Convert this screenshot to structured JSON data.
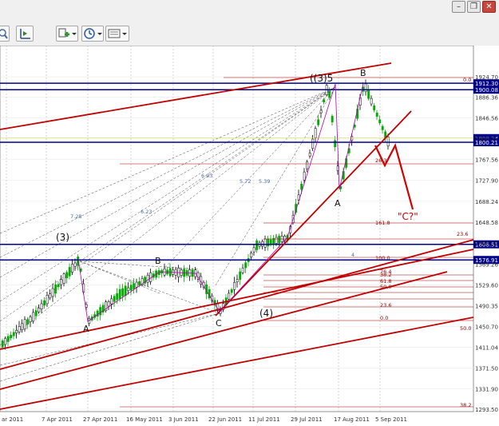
{
  "window": {
    "buttons": [
      {
        "name": "minimize",
        "glyph": "–"
      },
      {
        "name": "restore",
        "glyph": "❐"
      },
      {
        "name": "close",
        "glyph": "✕"
      }
    ]
  },
  "toolbar": {
    "icons": [
      "zoom-icon",
      "chart-shift-icon",
      "indicators-icon",
      "periods-icon",
      "templates-icon"
    ]
  },
  "chart": {
    "price_axis": [
      "1924.70",
      "1886.36",
      "1846.56",
      "1808.21",
      "1767.56",
      "1727.90",
      "1688.24",
      "1648.58",
      "1608.92",
      "1569.26",
      "1529.60",
      "1490.35",
      "1450.70",
      "1411.04",
      "1371.50",
      "1331.90",
      "1293.50"
    ],
    "price_tags": [
      {
        "label": "1912.30",
        "price": 1912.3
      },
      {
        "label": "1900.08",
        "price": 1900.08
      },
      {
        "label": "1808.24",
        "price": 1808.24
      },
      {
        "label": "1800.21",
        "price": 1800.21
      },
      {
        "label": "1606.51",
        "price": 1606.51
      },
      {
        "label": "1576.91",
        "price": 1576.91
      }
    ],
    "date_axis": [
      "ar 2011",
      "7 Apr 2011",
      "27 Apr 2011",
      "16 May 2011",
      "3 Jun 2011",
      "22 Jun 2011",
      "11 Jul 2011",
      "29 Jul 2011",
      "17 Aug 2011",
      "5 Sep 2011"
    ],
    "wave_labels": [
      {
        "text": "(3)",
        "big": true
      },
      {
        "text": "A",
        "big": false
      },
      {
        "text": "B",
        "big": false
      },
      {
        "text": "C",
        "big": false
      },
      {
        "text": "(4)",
        "big": true
      },
      {
        "text": "((3)5",
        "big": true
      },
      {
        "text": "A",
        "big": false
      },
      {
        "text": "B",
        "big": false
      },
      {
        "text": "\"C?\"",
        "big": true
      }
    ],
    "fib_labels": [
      "0.0",
      "161.8",
      "100.0",
      "23.6",
      "38.2",
      "50.0",
      "61.8",
      "76.4",
      "0.0",
      "23.6",
      "50.0",
      "38.2",
      "26.3"
    ],
    "fan_labels": [
      "5.72",
      "5.39",
      "6.93",
      "7.28",
      "6.23",
      "4"
    ],
    "colors": {
      "candle_up": "#00aa00",
      "candle_down": "#000000",
      "horizontal_blue": "#00008b",
      "trend_red": "#c00000",
      "fib_line": "#a00000",
      "tag_bg": "#00008b",
      "arrow_red": "#d40000",
      "wave_line": "#b000b0"
    }
  }
}
